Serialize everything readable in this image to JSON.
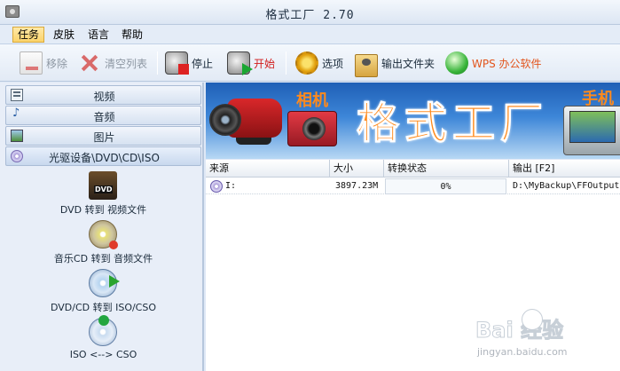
{
  "window": {
    "title": "格式工厂 2.70"
  },
  "menu": [
    {
      "label": "任务",
      "active": true
    },
    {
      "label": "皮肤",
      "active": false
    },
    {
      "label": "语言",
      "active": false
    },
    {
      "label": "帮助",
      "active": false
    }
  ],
  "toolbar": {
    "remove": "移除",
    "clear_list": "清空列表",
    "stop": "停止",
    "start": "开始",
    "options": "选项",
    "output_folder": "输出文件夹",
    "wps": "WPS 办公软件",
    "colors": {
      "start_label": "#d21c1c",
      "wps_label": "#e2541c",
      "disabled": "#8d97a3"
    }
  },
  "left_panel": {
    "categories": [
      {
        "label": "视频",
        "icon": "video-icon"
      },
      {
        "label": "音频",
        "icon": "audio-icon"
      },
      {
        "label": "图片",
        "icon": "image-icon"
      },
      {
        "label": "光驱设备\\DVD\\CD\\ISO",
        "icon": "disc-icon"
      }
    ],
    "items": [
      {
        "label": "DVD 转到 视频文件",
        "icon": "dvd-film-icon"
      },
      {
        "label": "音乐CD 转到 音频文件",
        "icon": "music-cd-icon"
      },
      {
        "label": "DVD/CD 转到 ISO/CSO",
        "icon": "disc-to-iso-icon"
      },
      {
        "label": "ISO <--> CSO",
        "icon": "iso-cso-icon"
      }
    ]
  },
  "banner": {
    "camera_label": "相机",
    "title": "格式工厂",
    "phone_label": "手机",
    "accent": "#ff8a1c"
  },
  "task_table": {
    "columns": [
      "来源",
      "大小",
      "转换状态",
      "输出 [F2]"
    ],
    "rows": [
      {
        "source": "I:",
        "size": "3897.23M",
        "status": "0%",
        "output": "D:\\MyBackup\\FFOutput"
      }
    ]
  },
  "watermark": {
    "text": "Bai 经验",
    "url": "jingyan.baidu.com"
  }
}
